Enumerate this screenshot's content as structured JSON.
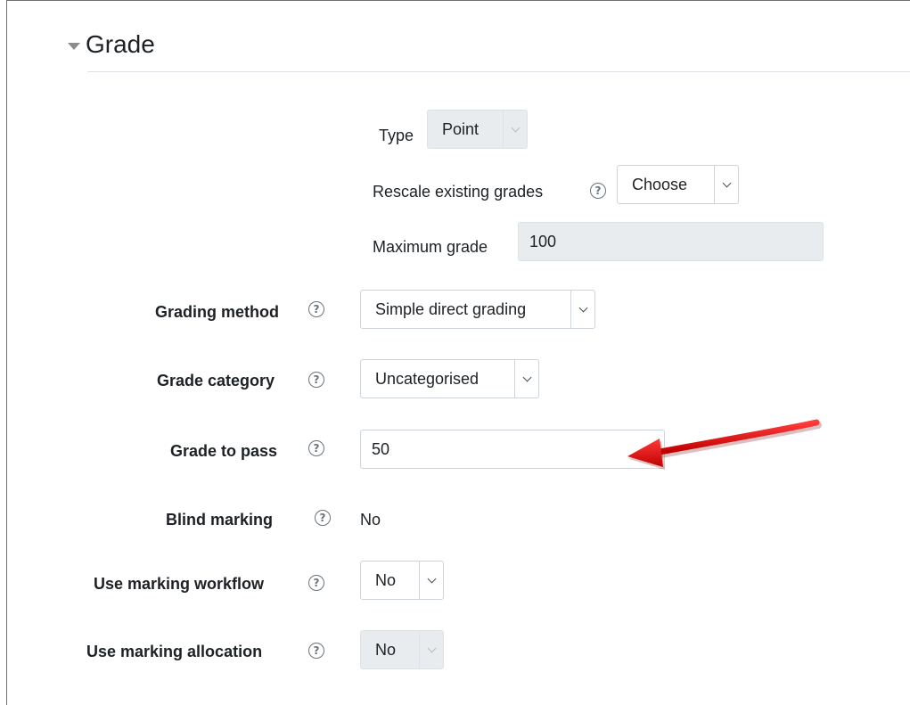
{
  "section": {
    "title": "Grade"
  },
  "grade_type": {
    "label": "Type",
    "value": "Point"
  },
  "rescale": {
    "label": "Rescale existing grades",
    "value": "Choose"
  },
  "max_grade": {
    "label": "Maximum grade",
    "value": "100"
  },
  "grading_method": {
    "label": "Grading method",
    "value": "Simple direct grading"
  },
  "grade_category": {
    "label": "Grade category",
    "value": "Uncategorised"
  },
  "grade_to_pass": {
    "label": "Grade to pass",
    "value": "50"
  },
  "blind_marking": {
    "label": "Blind marking",
    "value": "No"
  },
  "marking_workflow": {
    "label": "Use marking workflow",
    "value": "No"
  },
  "marking_allocation": {
    "label": "Use marking allocation",
    "value": "No"
  },
  "icons": {
    "help": "help-icon",
    "collapse": "caret-down-icon",
    "dropdown": "chevron-down-icon"
  },
  "colors": {
    "annotation_arrow": "#e01010",
    "disabled_bg": "#e9ecef"
  }
}
